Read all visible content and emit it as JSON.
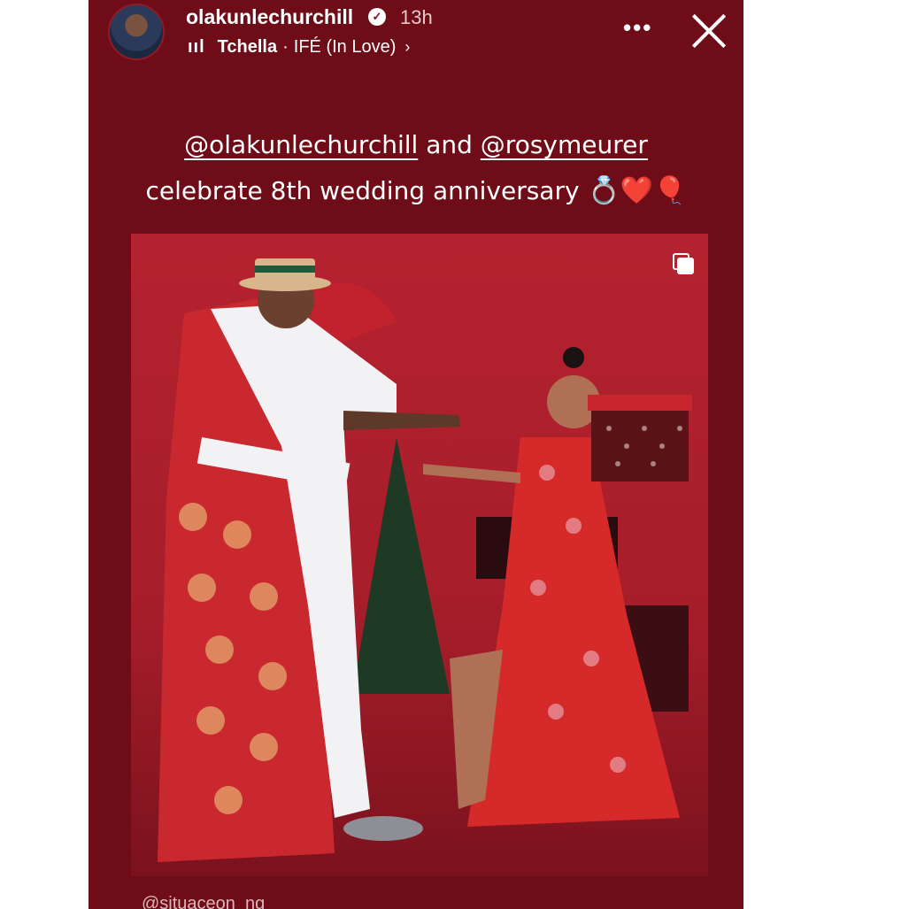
{
  "story": {
    "username": "olakunlechurchill",
    "time": "13h",
    "music": {
      "artist": "Tchella",
      "separator": "·",
      "song": "IFÉ (In Love)"
    },
    "caption": {
      "mention1": "@olakunlechurchill",
      "and": "and",
      "mention2": "@rosymeurer",
      "line2": "celebrate 8th wedding anniversary",
      "emojis": "💍❤️🎈"
    },
    "footer_tag": "@situaceon_ng"
  },
  "icons": {
    "verified": "verified-badge-icon",
    "music": "music-bars-icon",
    "more": "more-options-icon",
    "close": "close-icon",
    "carousel": "carousel-icon"
  },
  "colors": {
    "background": "#6e0c18",
    "accent": "#ffffff"
  }
}
